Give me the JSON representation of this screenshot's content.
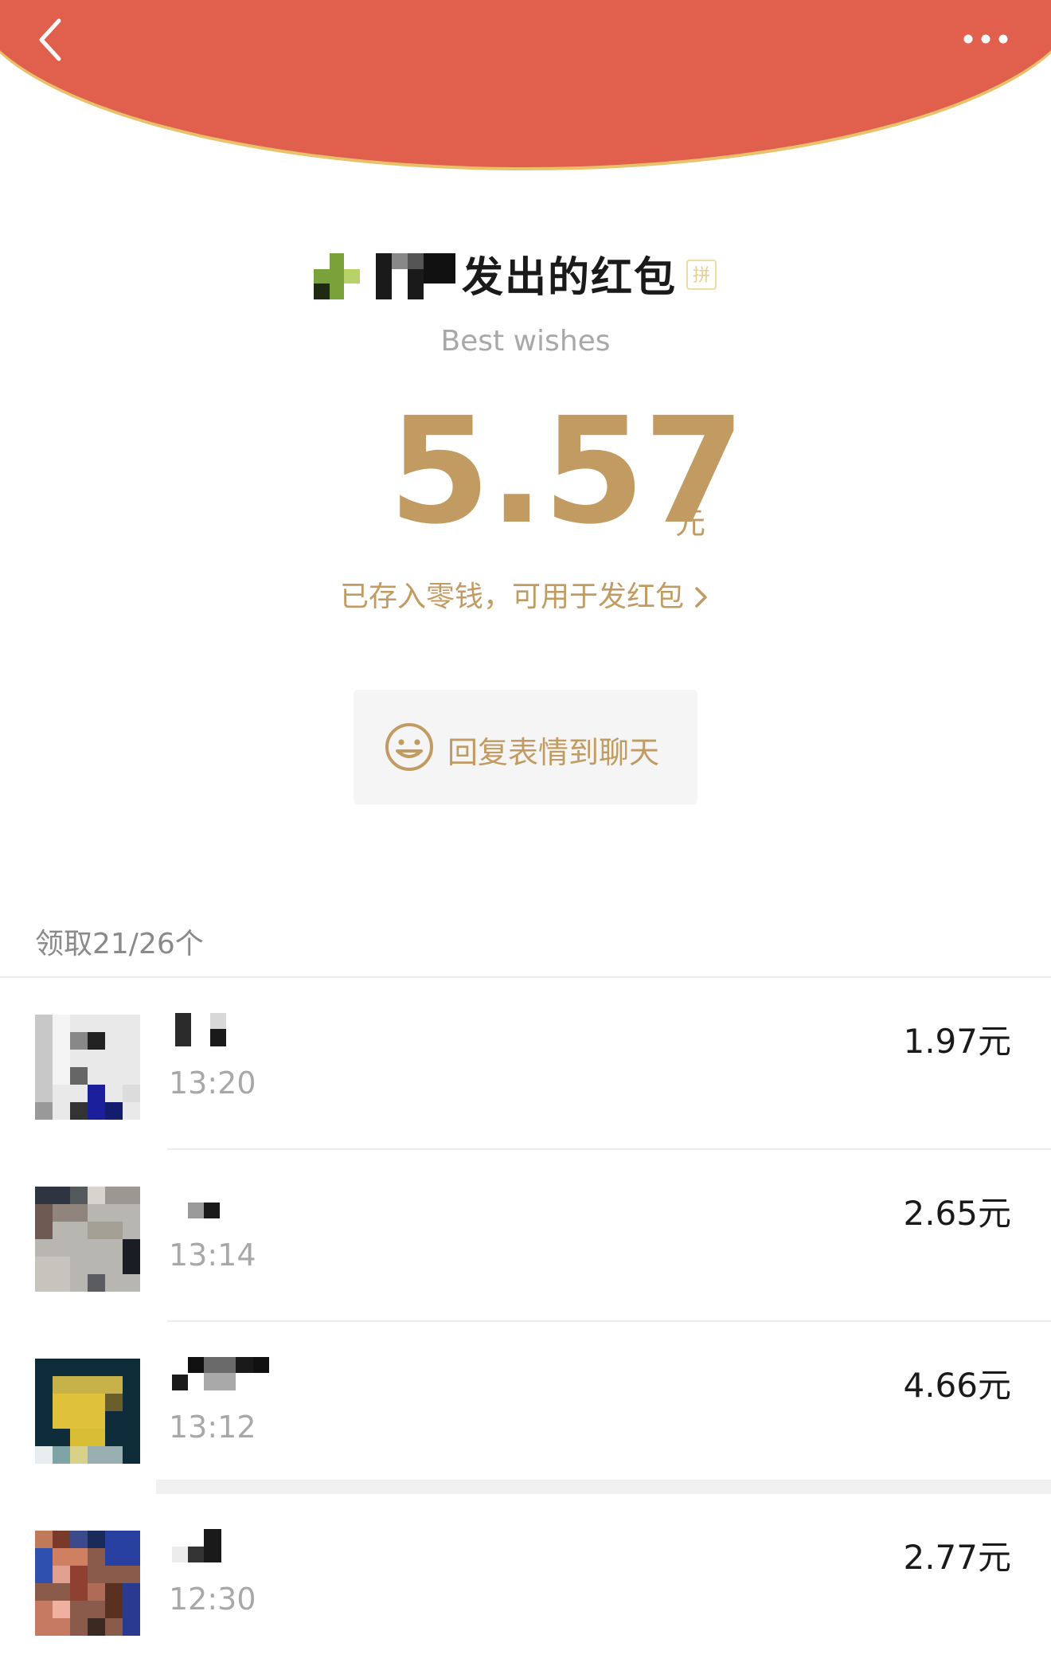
{
  "nav": {
    "back_icon": "chevron-left-icon",
    "more_icon": "more-dots-icon"
  },
  "colors": {
    "header_red": "#e05f4d",
    "header_edge_gold": "#e8c16a",
    "accent_gold": "#c19b62",
    "text_dark": "#1a1a1a",
    "text_grey": "#a8a8a8"
  },
  "packet": {
    "title": "发出的红包",
    "pin_badge": "拼",
    "blessing": "Best wishes",
    "amount": "5.57",
    "amount_unit": "元",
    "saved_note": "已存入零钱，可用于发红包",
    "reply_label": "回复表情到聊天",
    "reply_icon": "smile-face-icon"
  },
  "records": {
    "summary": "领取21/26个",
    "items": [
      {
        "time": "13:20",
        "amount": "1.97元"
      },
      {
        "time": "13:14",
        "amount": "2.65元"
      },
      {
        "time": "13:12",
        "amount": "4.66元"
      },
      {
        "time": "12:30",
        "amount": "2.77元"
      }
    ]
  }
}
